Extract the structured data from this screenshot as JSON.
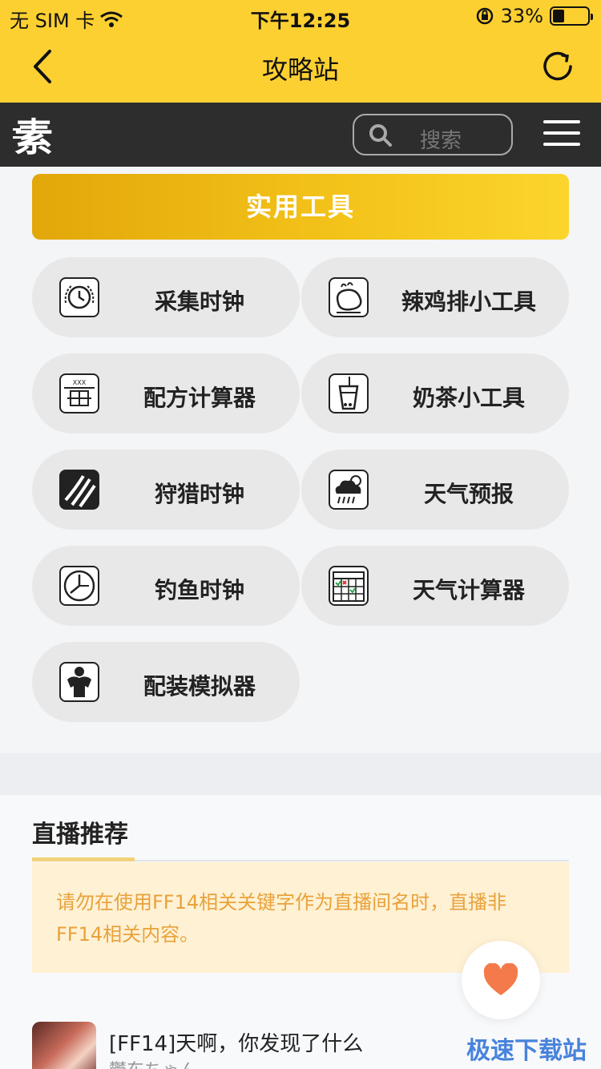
{
  "status_bar": {
    "carrier": "无 SIM 卡",
    "time": "下午12:25",
    "battery": "33%",
    "battery_level": 0.33
  },
  "nav": {
    "title": "攻略站"
  },
  "site_header": {
    "logo_text": "素",
    "search_placeholder": "搜索"
  },
  "tools_section": {
    "title": "实用工具",
    "items": [
      {
        "label": "采集时钟",
        "icon": "clock-wreath-icon"
      },
      {
        "label": "辣鸡排小工具",
        "icon": "chicken-icon"
      },
      {
        "label": "配方计算器",
        "icon": "recipe-icon"
      },
      {
        "label": "奶茶小工具",
        "icon": "milk-tea-icon"
      },
      {
        "label": "狩猎时钟",
        "icon": "claw-icon"
      },
      {
        "label": "天气预报",
        "icon": "cloud-rain-icon"
      },
      {
        "label": "钓鱼时钟",
        "icon": "clock-icon"
      },
      {
        "label": "天气计算器",
        "icon": "calendar-icon"
      },
      {
        "label": "配装模拟器",
        "icon": "armor-icon"
      }
    ]
  },
  "live_section": {
    "title": "直播推荐",
    "notice": "请勿在使用FF14相关关键字作为直播间名时，直播非FF14相关内容。",
    "stream": {
      "title": "[FF14]天啊，你发现了什么",
      "subtitle": "鬱东ちゃん"
    }
  },
  "watermark": "极速下载站",
  "colors": {
    "accent": "#fdd032",
    "header_dark": "#2d2d2d",
    "notice_text": "#e8a23a",
    "heart": "#f57a4b"
  }
}
